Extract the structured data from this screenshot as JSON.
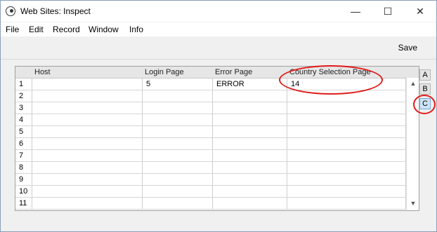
{
  "window": {
    "title": "Web Sites: Inspect"
  },
  "window_controls": {
    "minimize": "—",
    "maximize": "☐",
    "close": "✕"
  },
  "menu": {
    "items": [
      "File",
      "Edit",
      "Record",
      "Window",
      "Info"
    ]
  },
  "toolbar": {
    "save_label": "Save"
  },
  "grid": {
    "columns": [
      "Host",
      "Login Page",
      "Error Page",
      "Country Selection Page"
    ],
    "rows": [
      {
        "num": "1",
        "cells": [
          "",
          "5",
          "ERROR",
          "14"
        ]
      },
      {
        "num": "2",
        "cells": [
          "",
          "",
          "",
          ""
        ]
      },
      {
        "num": "3",
        "cells": [
          "",
          "",
          "",
          ""
        ]
      },
      {
        "num": "4",
        "cells": [
          "",
          "",
          "",
          ""
        ]
      },
      {
        "num": "5",
        "cells": [
          "",
          "",
          "",
          ""
        ]
      },
      {
        "num": "6",
        "cells": [
          "",
          "",
          "",
          ""
        ]
      },
      {
        "num": "7",
        "cells": [
          "",
          "",
          "",
          ""
        ]
      },
      {
        "num": "8",
        "cells": [
          "",
          "",
          "",
          ""
        ]
      },
      {
        "num": "9",
        "cells": [
          "",
          "",
          "",
          ""
        ]
      },
      {
        "num": "10",
        "cells": [
          "",
          "",
          "",
          ""
        ]
      },
      {
        "num": "11",
        "cells": [
          "",
          "",
          "",
          ""
        ]
      }
    ]
  },
  "scrollbar": {
    "up": "▲",
    "down": "▼"
  },
  "cards": {
    "tabs": [
      "A",
      "B",
      "C"
    ],
    "active": "C"
  },
  "annotation_color": "#e01b1b"
}
